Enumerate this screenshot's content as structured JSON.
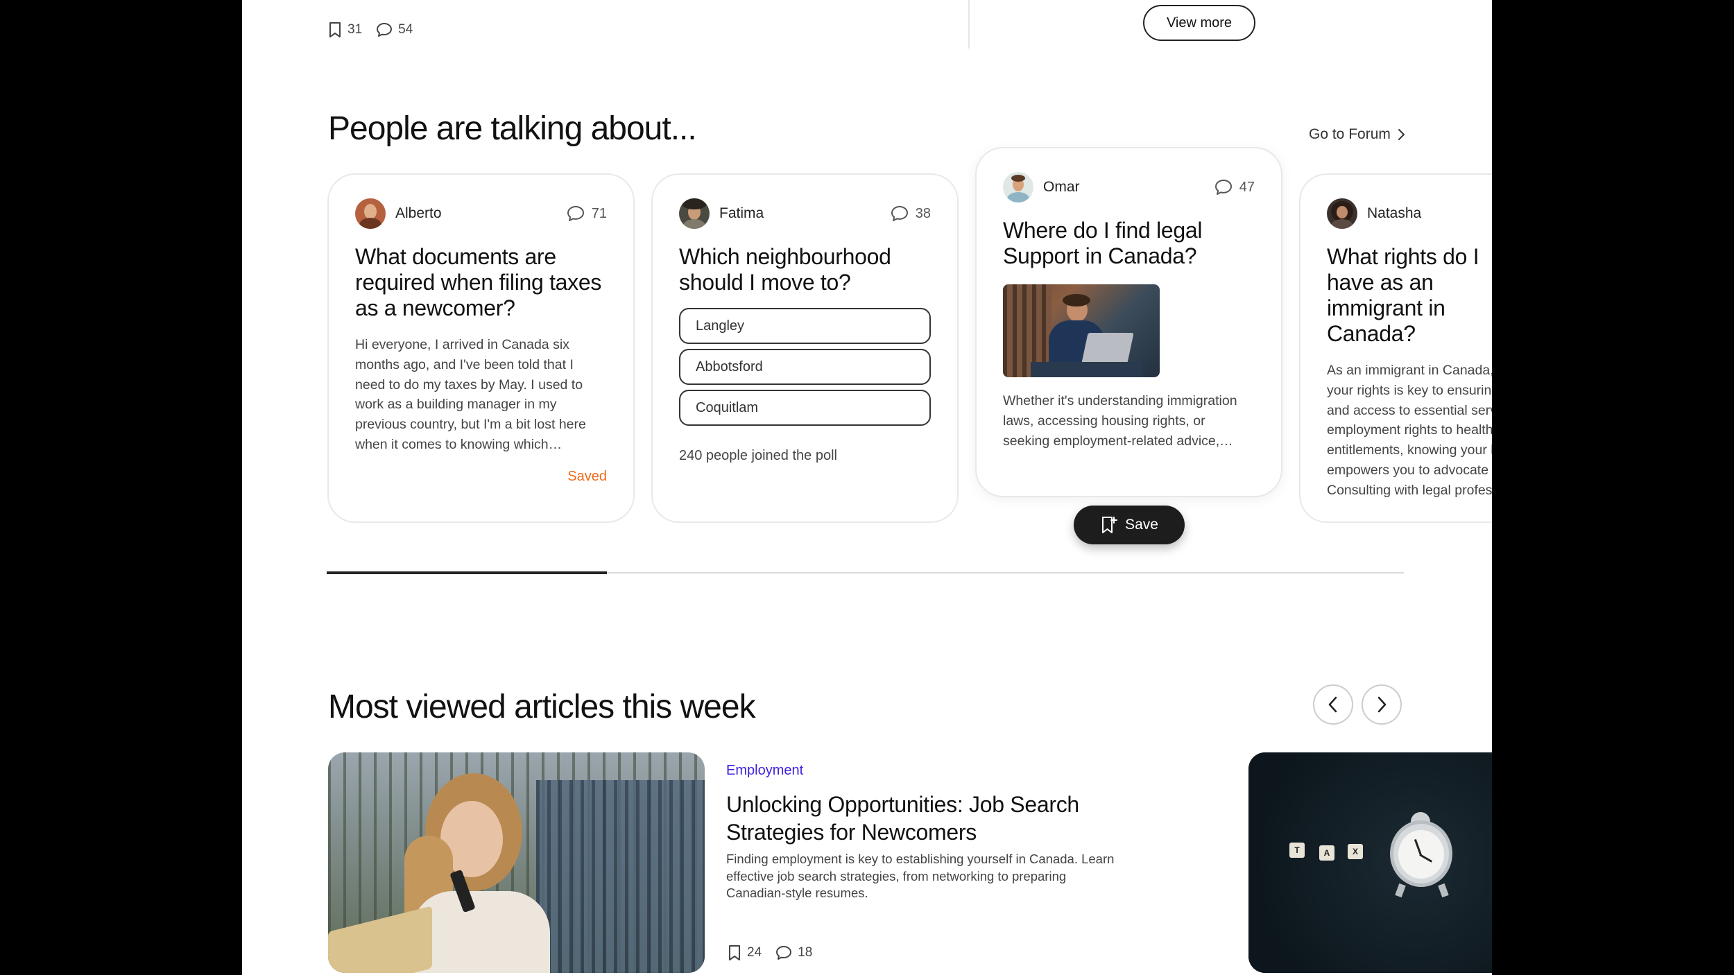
{
  "top": {
    "bookmarks": "31",
    "comments": "54",
    "view_more": "View more"
  },
  "forum": {
    "title": "People are talking about...",
    "go_to_forum": "Go to Forum",
    "save_label": "Save",
    "progress": 0.26,
    "cards": [
      {
        "author": "Alberto",
        "comments": "71",
        "title": "What documents are required when filing taxes as a newcomer?",
        "body": "Hi everyone, I arrived in Canada six months ago, and I've been told that I need to do my taxes by May. I used to work as a building manager in my previous country, but I'm a bit lost here when it comes to knowing which documents I need. I've heard about things like T4 slips and notices of assessment, but I'm not sure what applies to me.",
        "status": "Saved"
      },
      {
        "author": "Fatima",
        "comments": "38",
        "title": "Which neighbourhood should I move to?",
        "poll_options": [
          "Langley",
          "Abbotsford",
          "Coquitlam"
        ],
        "poll_count": "240 people joined the poll"
      },
      {
        "author": "Omar",
        "comments": "47",
        "title": "Where do I find legal Support in Canada?",
        "body": "Whether it's understanding immigration laws, accessing housing rights, or seeking employment-related advice, knowing where to find reliable legal support is essential for newcomers."
      },
      {
        "author": "Natasha",
        "title": "What rights do I have as an immigrant in Canada?",
        "body": "As an immigrant in Canada, understanding your rights is key to ensuring fair treatment and access to essential services. From employment rights to healthcare entitlements, knowing your legal protections empowers you to advocate for themselves. Consulting with legal professionals"
      }
    ]
  },
  "articles": {
    "title": "Most viewed articles this week",
    "featured": {
      "category": "Employment",
      "title": "Unlocking Opportunities: Job Search Strategies for Newcomers",
      "excerpt": "Finding employment is key to establishing yourself in Canada. Learn effective job search strategies, from networking to preparing Canadian-style resumes.",
      "bookmarks": "24",
      "comments": "18"
    },
    "tiles": [
      "T",
      "A",
      "X"
    ]
  }
}
